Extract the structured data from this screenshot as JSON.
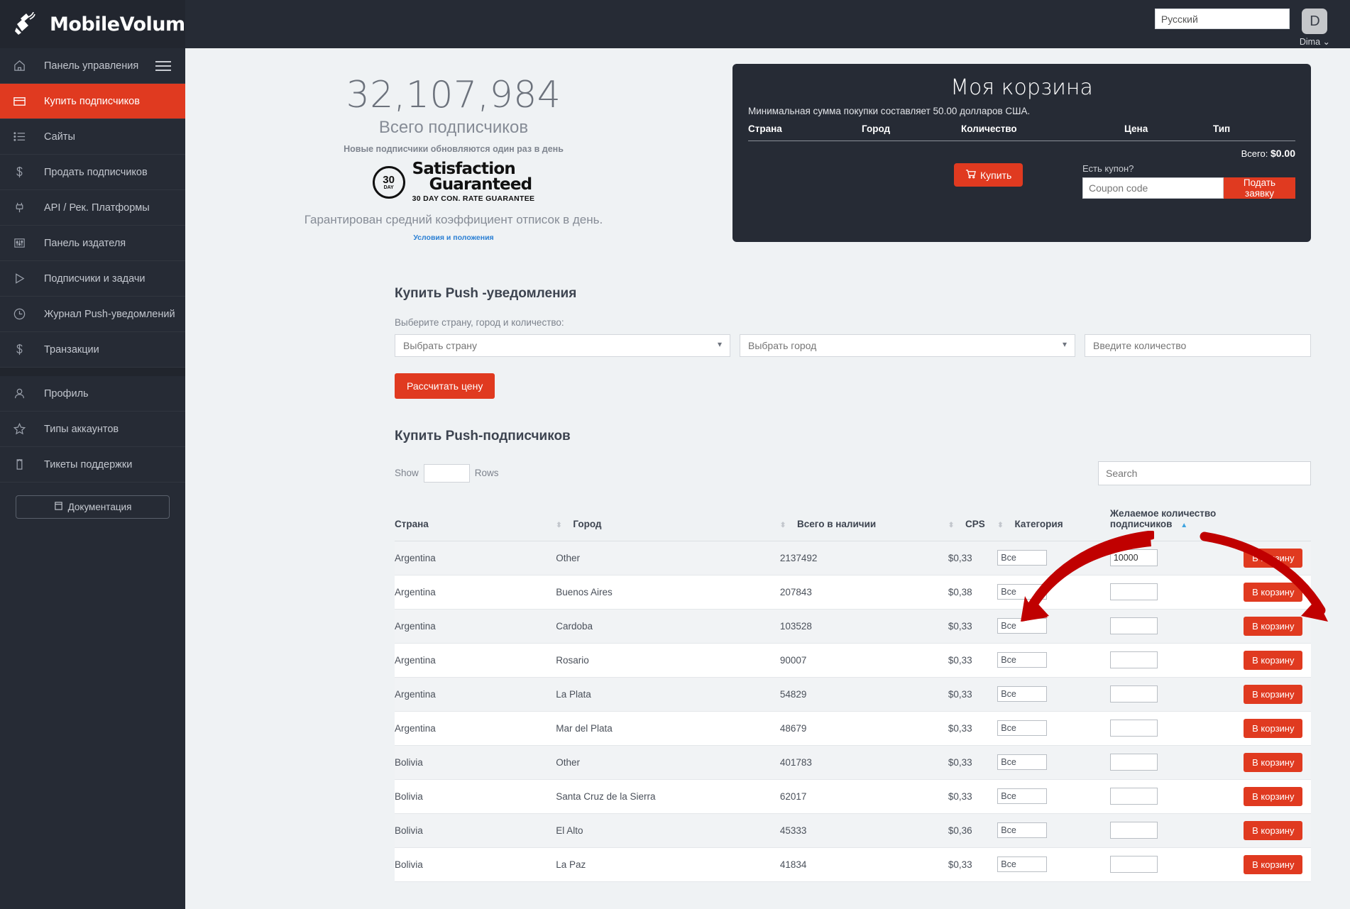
{
  "brand": {
    "name": "MobileVolume",
    "logo_icon": "phone-signal-icon"
  },
  "topbar": {
    "language_value": "Русский",
    "avatar_letter": "D",
    "user_name": "Dima",
    "chevron_icon": "chevron-down-icon"
  },
  "sidebar": {
    "menu_icon": "hamburger-icon",
    "items": [
      {
        "label": "Панель управления",
        "icon": "home-icon",
        "active": false
      },
      {
        "label": "Купить подписчиков",
        "icon": "card-icon",
        "active": true
      },
      {
        "label": "Сайты",
        "icon": "list-icon",
        "active": false
      },
      {
        "label": "Продать подписчиков",
        "icon": "dollar-icon",
        "active": false
      },
      {
        "label": "API / Рек. Платформы",
        "icon": "plug-icon",
        "active": false
      },
      {
        "label": "Панель издателя",
        "icon": "sliders-icon",
        "active": false
      },
      {
        "label": "Подписчики и задачи",
        "icon": "play-icon",
        "active": false
      },
      {
        "label": "Журнал Push-уведомлений",
        "icon": "clock-icon",
        "active": false
      },
      {
        "label": "Транзакции",
        "icon": "dollar-icon",
        "active": false
      }
    ],
    "items2": [
      {
        "label": "Профиль",
        "icon": "user-icon",
        "active": false
      },
      {
        "label": "Типы аккаунтов",
        "icon": "star-icon",
        "active": false
      },
      {
        "label": "Тикеты поддержки",
        "icon": "ticket-icon",
        "active": false
      }
    ],
    "documentation_label": "Документация",
    "documentation_icon": "book-icon"
  },
  "hero": {
    "count": "32,107,984",
    "count_label": "Всего подписчиков",
    "update_note": "Новые подписчики обновляются один раз в день",
    "seal_number": "30",
    "seal_day": "DAY",
    "guarantee_line1": "Satisfaction",
    "guarantee_line2": "Guaranteed",
    "guarantee_line3": "30 DAY CON. RATE  GUARANTEE",
    "rate_line": "Гарантирован средний коэффициент отписок в день.",
    "terms_link": "Условия и положения"
  },
  "cart": {
    "title": "Моя корзина",
    "min_purchase": "Минимальная сумма покупки составляет 50.00 долларов США.",
    "columns": [
      "Страна",
      "Город",
      "Количество",
      "Цена",
      "Тип"
    ],
    "total_label": "Всего:",
    "total_value": "$0.00",
    "buy_label": "Купить",
    "buy_icon": "cart-icon",
    "coupon_label": "Есть купон?",
    "coupon_placeholder": "Coupon code",
    "coupon_button": "Подать заявку"
  },
  "buy_section": {
    "title": "Купить Push -уведомления",
    "field_label": "Выберите страну, город и количество:",
    "country_placeholder": "Выбрать страну",
    "city_placeholder": "Выбрать город",
    "amount_placeholder": "Введите количество",
    "calc_button": "Рассчитать цену"
  },
  "table_section": {
    "title": "Купить Push-подписчиков",
    "show_label": "Show",
    "show_value": "",
    "rows_label": "Rows",
    "search_placeholder": "Search",
    "columns": [
      "Страна",
      "Город",
      "Всего в наличии",
      "CPS",
      "Категория",
      "Желаемое количество подписчиков"
    ],
    "add_to_cart_label": "В корзину",
    "rows": [
      {
        "country": "Argentina",
        "city": "Other",
        "total": "2137492",
        "cps": "$0,33",
        "category": "Все",
        "desired": "10000"
      },
      {
        "country": "Argentina",
        "city": "Buenos Aires",
        "total": "207843",
        "cps": "$0,38",
        "category": "Все",
        "desired": ""
      },
      {
        "country": "Argentina",
        "city": "Cardoba",
        "total": "103528",
        "cps": "$0,33",
        "category": "Все",
        "desired": ""
      },
      {
        "country": "Argentina",
        "city": "Rosario",
        "total": "90007",
        "cps": "$0,33",
        "category": "Все",
        "desired": ""
      },
      {
        "country": "Argentina",
        "city": "La Plata",
        "total": "54829",
        "cps": "$0,33",
        "category": "Все",
        "desired": ""
      },
      {
        "country": "Argentina",
        "city": "Mar del Plata",
        "total": "48679",
        "cps": "$0,33",
        "category": "Все",
        "desired": ""
      },
      {
        "country": "Bolivia",
        "city": "Other",
        "total": "401783",
        "cps": "$0,33",
        "category": "Все",
        "desired": ""
      },
      {
        "country": "Bolivia",
        "city": "Santa Cruz de la Sierra",
        "total": "62017",
        "cps": "$0,33",
        "category": "Все",
        "desired": ""
      },
      {
        "country": "Bolivia",
        "city": "El Alto",
        "total": "45333",
        "cps": "$0,36",
        "category": "Все",
        "desired": ""
      },
      {
        "country": "Bolivia",
        "city": "La Paz",
        "total": "41834",
        "cps": "$0,33",
        "category": "Все",
        "desired": ""
      }
    ]
  },
  "colors": {
    "accent": "#e03a20",
    "sidebar_bg": "#262b35",
    "page_bg": "#eff2f4",
    "annotation": "#c00000"
  }
}
